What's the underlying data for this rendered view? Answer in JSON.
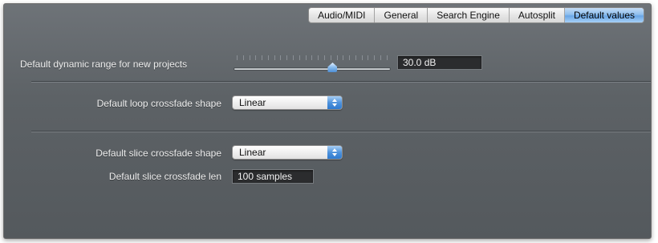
{
  "tabs": [
    {
      "label": "Audio/MIDI",
      "active": false
    },
    {
      "label": "General",
      "active": false
    },
    {
      "label": "Search Engine",
      "active": false
    },
    {
      "label": "Autosplit",
      "active": false
    },
    {
      "label": "Default values",
      "active": true
    }
  ],
  "settings": {
    "dynamic_range": {
      "label": "Default dynamic range for new projects",
      "value": "30.0 dB",
      "slider_fraction": 0.63
    },
    "loop_crossfade_shape": {
      "label": "Default loop crossfade shape",
      "selected": "Linear"
    },
    "slice_crossfade_shape": {
      "label": "Default slice crossfade shape",
      "selected": "Linear"
    },
    "slice_crossfade_len": {
      "label": "Default slice crossfade len",
      "value": "100 samples"
    }
  },
  "colors": {
    "panel_background": "#5d6266",
    "active_tab": "#8fbfee",
    "popup_arrow": "#4f93dc"
  },
  "icons": {
    "popup_arrows": "up-down-arrows-icon",
    "slider_knob": "slider-knob-icon"
  }
}
